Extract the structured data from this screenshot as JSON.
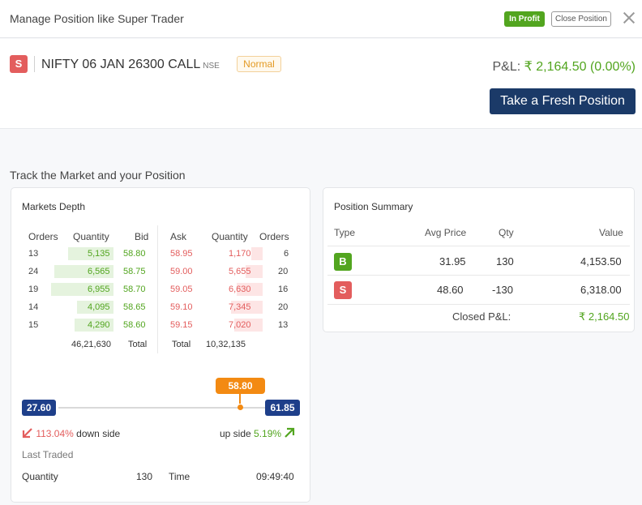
{
  "header": {
    "title": "Manage Position like Super Trader",
    "status_badge": "In Profit",
    "close_position_label": "Close Position"
  },
  "instrument": {
    "side": "S",
    "name": "NIFTY 06 JAN 26300 CALL",
    "exchange": "NSE",
    "order_type": "Normal",
    "pnl_label": "P&L:",
    "pnl_value": "₹ 2,164.50 (0.00%)",
    "fresh_position_label": "Take a Fresh Position"
  },
  "section_title": "Track the Market and your Position",
  "market_depth": {
    "title": "Markets Depth",
    "headers": {
      "bid_orders": "Orders",
      "bid_qty": "Quantity",
      "bid": "Bid",
      "ask": "Ask",
      "ask_qty": "Quantity",
      "ask_orders": "Orders"
    },
    "bids": [
      {
        "orders": "13",
        "qty": "5,135",
        "price": "58.80",
        "fill": 0.4
      },
      {
        "orders": "24",
        "qty": "6,565",
        "price": "58.75",
        "fill": 0.52
      },
      {
        "orders": "19",
        "qty": "6,955",
        "price": "58.70",
        "fill": 0.55
      },
      {
        "orders": "14",
        "qty": "4,095",
        "price": "58.65",
        "fill": 0.32
      },
      {
        "orders": "15",
        "qty": "4,290",
        "price": "58.60",
        "fill": 0.34
      }
    ],
    "asks": [
      {
        "price": "58.95",
        "qty": "1,170",
        "orders": "6",
        "fill": 0.2
      },
      {
        "price": "59.00",
        "qty": "5,655",
        "orders": "20",
        "fill": 0.3
      },
      {
        "price": "59.05",
        "qty": "6,630",
        "orders": "16",
        "fill": 0.45
      },
      {
        "price": "59.10",
        "qty": "7,345",
        "orders": "20",
        "fill": 0.55
      },
      {
        "price": "59.15",
        "qty": "7,020",
        "orders": "13",
        "fill": 0.5
      }
    ],
    "bid_total_qty": "46,21,630",
    "bid_total_label": "Total",
    "ask_total_label": "Total",
    "ask_total_qty": "10,32,135",
    "low": "27.60",
    "high": "61.85",
    "ltp": "58.80",
    "down_pct": "113.04%",
    "down_label": "down side",
    "up_label": "up side",
    "up_pct": "5.19%",
    "last_traded_label": "Last Traded",
    "quantity_label": "Quantity",
    "quantity_value": "130",
    "time_label": "Time",
    "time_value": "09:49:40",
    "colors": {
      "green": "#52a51f",
      "red": "#e35d5d",
      "orange": "#f38a12",
      "navy": "#1e3f8a"
    }
  },
  "position_summary": {
    "title": "Position Summary",
    "headers": {
      "type": "Type",
      "avg_price": "Avg Price",
      "qty": "Qty",
      "value": "Value"
    },
    "rows": [
      {
        "type": "B",
        "avg_price": "31.95",
        "qty": "130",
        "value": "4,153.50"
      },
      {
        "type": "S",
        "avg_price": "48.60",
        "qty": "-130",
        "value": "6,318.00"
      }
    ],
    "closed_pnl_label": "Closed P&L:",
    "closed_pnl_value": "₹ 2,164.50"
  }
}
